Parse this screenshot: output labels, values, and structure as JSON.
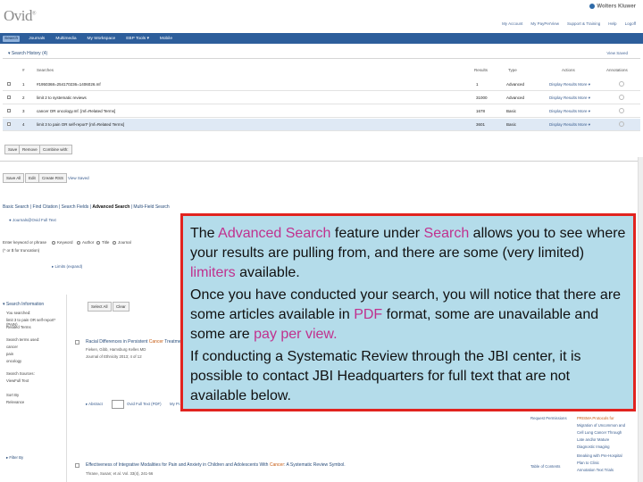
{
  "app": {
    "logo": "Ovid",
    "brand": "Wolters Kluwer",
    "utility_links": [
      "My Account",
      "My PayPerView",
      "Support & Training",
      "Help",
      "Logoff"
    ]
  },
  "nav": {
    "items": [
      "Search",
      "Journals",
      "Multimedia",
      "My Workspace",
      "EBP Tools ▾",
      "Mobile"
    ]
  },
  "history": {
    "tab_label": "▾ Search History (4)",
    "view_saved": "View Saved",
    "columns": [
      "#",
      "Searches",
      "Results",
      "Type",
      "Actions",
      "Annotations"
    ],
    "rows": [
      {
        "num": "1",
        "search": "#1950368=254170236=1406026.mf",
        "results": "1",
        "type": "Advanced",
        "actions": "Display Results  More ▾"
      },
      {
        "num": "2",
        "search": "limit 2 to systematic reviews",
        "results": "31000",
        "type": "Advanced",
        "actions": "Display Results  More ▾"
      },
      {
        "num": "3",
        "search": "cancer OR oncology.mf. [mf=Related Terms]",
        "results": "1678",
        "type": "Basic",
        "actions": "Display Results  More ▾"
      },
      {
        "num": "4",
        "search": "limit 3 to pain OR self-report* [mf=Related Terms]",
        "results": "3601",
        "type": "Basic",
        "actions": "Display Results  More ▾"
      }
    ],
    "buttons": [
      "Save",
      "Remove",
      "Combine with:"
    ],
    "bottom_buttons": [
      "Save All",
      "Edit",
      "Create RSS",
      "View Saved"
    ]
  },
  "search_tabs": {
    "prefix": "Basic Search | Find Citation | Search Fields | ",
    "active": "Advanced Search",
    "suffix": " | Multi-Field Search"
  },
  "search_form": {
    "resources": "● Journals@Ovid Full Text",
    "enter_keyword_label": "Enter keyword or phrase",
    "shortcut_label": "(* or $ for truncation)",
    "options": [
      "Keyword",
      "Author",
      "Title",
      "Journal"
    ],
    "limits_label": "▸ Limits (expand)"
  },
  "panel": {
    "head": "▾ Search Information",
    "lines": [
      "You searched:",
      "limit 3 to pain OR self-report* (PAIN)",
      "Related Terms",
      "Search terms used:",
      "cancer",
      "pain",
      "oncology",
      "Search Sources:",
      "ViewFull Text",
      "Sort By",
      "Relevance",
      "▸ Filter By"
    ]
  },
  "results": {
    "toolbar_buttons": [
      "Select All",
      "Clear"
    ],
    "items": [
      {
        "pre": "Racial Differences in Persistent ",
        "hit": "Cancer",
        "post": " Treatment ...",
        "authors": "Fieken, Gibb, Hamsburg Kelles MD",
        "source": "Journal of Ethnicity 2013; 4 of 12",
        "link_abstract": "▸ Abstract",
        "link_pdf": "Ovid Full Text (PDF)",
        "link_mypdf": "My Pr...",
        "side": "Request Permissions"
      },
      {
        "pre": "Effectiveness of Integrative Modalities for Pain and Anxiety in Children and Adolescents With ",
        "hit": "Cancer",
        "post": ": A Systematic Review Symbol.",
        "authors": "Thrane, Susan; et al.  Vol. 33(4), 241-56",
        "source": "",
        "link_abstract": "",
        "link_pdf": "",
        "link_mypdf": "",
        "side": "Table of Contents"
      }
    ],
    "side_links": [
      "PRISMA Protocols for",
      "Migration of Uncommon and",
      "Cell Lung Cancer Through",
      "Late and/or Mature",
      "Diagnostic Imaging",
      "Breaking with Pre-Hospital",
      "Plan to Clinic",
      "Annotation Text Trials"
    ]
  },
  "overlay": {
    "p1": [
      {
        "text": "The ",
        "hl": false
      },
      {
        "text": "Advanced Search",
        "hl": true
      },
      {
        "text": " feature under ",
        "hl": false
      },
      {
        "text": "Search",
        "hl": true
      },
      {
        "text": " allows you to see where your results are pulling from, and there are some (very limited) ",
        "hl": false
      },
      {
        "text": "limiters",
        "hl": true
      },
      {
        "text": " available.",
        "hl": false
      }
    ],
    "p2": [
      {
        "text": "Once you have conducted your search, you will notice that there are some articles available in ",
        "hl": false
      },
      {
        "text": "PDF",
        "hl": true
      },
      {
        "text": " format, some are unavailable and some are ",
        "hl": false
      },
      {
        "text": "pay per view.",
        "hl": true
      }
    ],
    "p3": [
      {
        "text": "If conducting a Systematic Review through the JBI center, it is possible to contact JBI Headquarters for full text that are not available below.",
        "hl": false
      }
    ]
  },
  "colors": {
    "nav": "#2d5e9b",
    "overlay_bg": "#b4dcea",
    "overlay_border": "#e1231f",
    "highlight": "#c0318e"
  }
}
